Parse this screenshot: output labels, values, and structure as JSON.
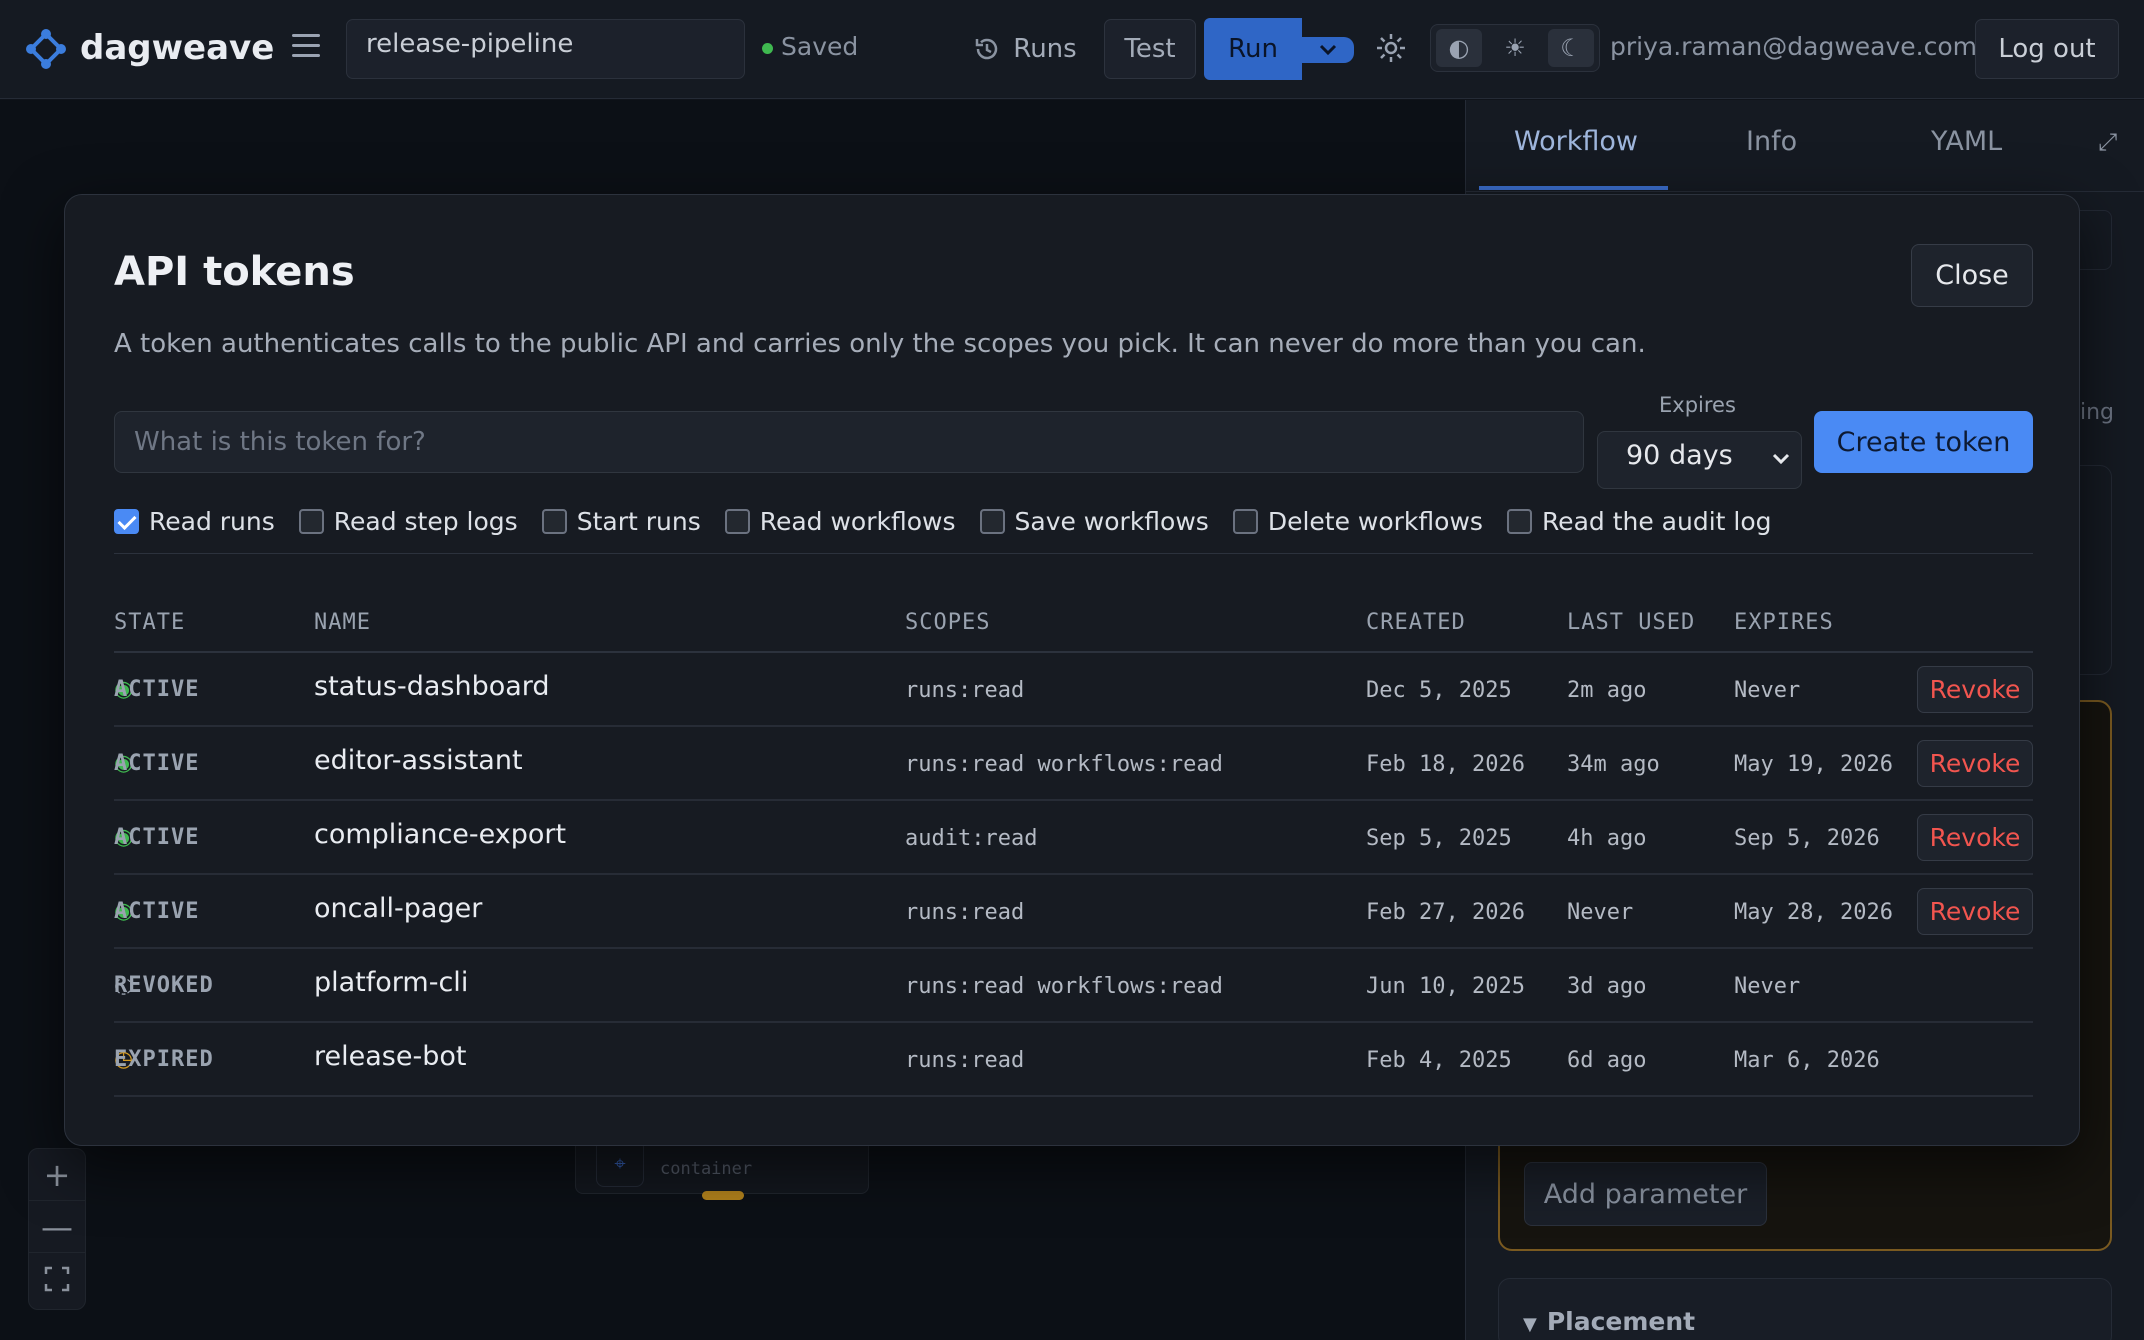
{
  "header": {
    "brand": "dagweave",
    "workflow_name": "release-pipeline",
    "saved_status": "Saved",
    "runs_label": "Runs",
    "test_label": "Test",
    "run_label": "Run",
    "theme_options": [
      "◐",
      "☀",
      "☾"
    ],
    "user_email": "priya.raman@dagweave.com",
    "logout_label": "Log out"
  },
  "right_panel": {
    "tabs": [
      "Workflow",
      "Info",
      "YAML"
    ],
    "active_tab": "Workflow",
    "peek_text": "ing",
    "add_parameter_label": "Add parameter",
    "placement_label": "Placement"
  },
  "canvas": {
    "node_type": "container",
    "zoom_in": "+",
    "zoom_out": "—"
  },
  "modal": {
    "title": "API tokens",
    "close_label": "Close",
    "description": "A token authenticates calls to the public API and carries only the scopes you pick. It can never do more than you can.",
    "input_placeholder": "What is this token for?",
    "expires_label": "Expires",
    "expires_value": "90 days",
    "create_label": "Create token",
    "scopes": [
      {
        "label": "Read runs",
        "checked": true
      },
      {
        "label": "Read step logs",
        "checked": false
      },
      {
        "label": "Start runs",
        "checked": false
      },
      {
        "label": "Read workflows",
        "checked": false
      },
      {
        "label": "Save workflows",
        "checked": false
      },
      {
        "label": "Delete workflows",
        "checked": false
      },
      {
        "label": "Read the audit log",
        "checked": false
      }
    ],
    "columns": [
      "STATE",
      "NAME",
      "SCOPES",
      "CREATED",
      "LAST USED",
      "EXPIRES"
    ],
    "rows": [
      {
        "state": "ACTIVE",
        "glyph": "◉",
        "name": "status-dashboard",
        "scopes": "runs:read",
        "created": "Dec 5, 2025",
        "last_used": "2m ago",
        "expires": "Never",
        "action": "Revoke"
      },
      {
        "state": "ACTIVE",
        "glyph": "◉",
        "name": "editor-assistant",
        "scopes": "runs:read workflows:read",
        "created": "Feb 18, 2026",
        "last_used": "34m ago",
        "expires": "May 19, 2026",
        "action": "Revoke"
      },
      {
        "state": "ACTIVE",
        "glyph": "◉",
        "name": "compliance-export",
        "scopes": "audit:read",
        "created": "Sep 5, 2025",
        "last_used": "4h ago",
        "expires": "Sep 5, 2026",
        "action": "Revoke"
      },
      {
        "state": "ACTIVE",
        "glyph": "◉",
        "name": "oncall-pager",
        "scopes": "runs:read",
        "created": "Feb 27, 2026",
        "last_used": "Never",
        "expires": "May 28, 2026",
        "action": "Revoke"
      },
      {
        "state": "REVOKED",
        "glyph": "◌",
        "name": "platform-cli",
        "scopes": "runs:read workflows:read",
        "created": "Jun 10, 2025",
        "last_used": "3d ago",
        "expires": "Never",
        "action": ""
      },
      {
        "state": "EXPIRED",
        "glyph": "◷",
        "name": "release-bot",
        "scopes": "runs:read",
        "created": "Feb 4, 2025",
        "last_used": "6d ago",
        "expires": "Mar 6, 2026",
        "action": ""
      }
    ]
  },
  "colors": {
    "accent": "#4a8af4",
    "active_state": "#3fb950",
    "expired_state": "#d29922",
    "revoke": "#f2554f"
  }
}
